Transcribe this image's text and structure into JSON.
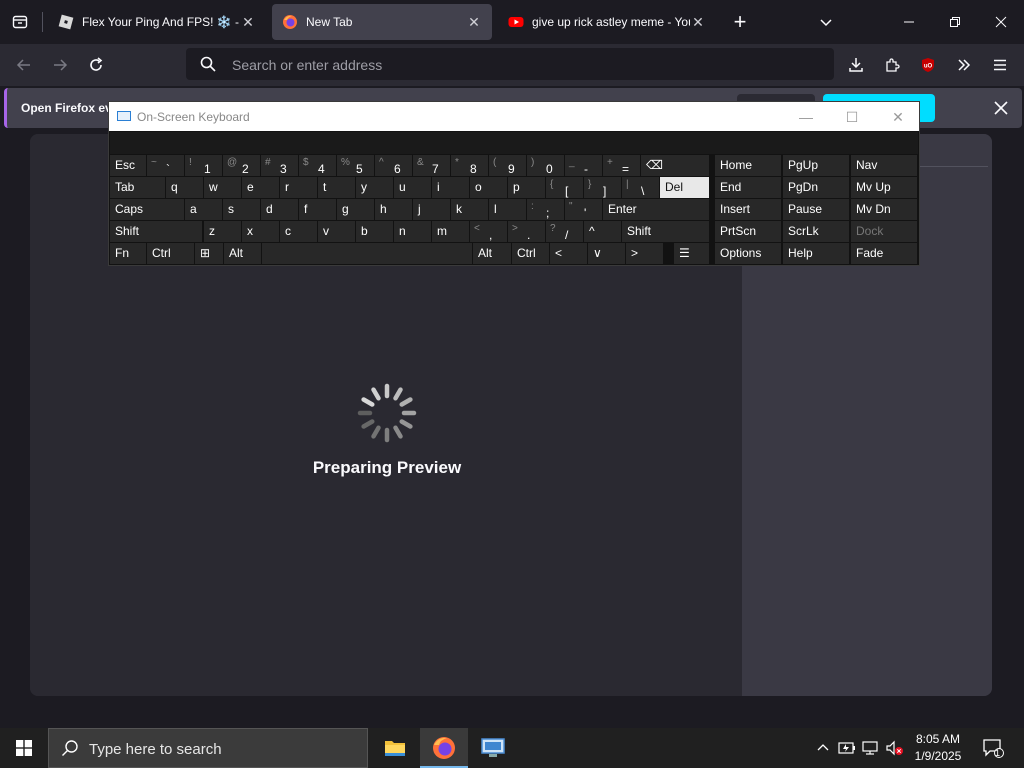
{
  "browser": {
    "tabs": [
      {
        "title": "Flex Your Ping And FPS! ❄️ - Roblox",
        "active": false
      },
      {
        "title": "New Tab",
        "active": true
      },
      {
        "title": "give up rick astley meme - YouTube",
        "active": false
      }
    ],
    "new_tab_symbol": "+",
    "url_placeholder": "Search or enter address",
    "notification": "Open Firefox everywhere you browse"
  },
  "content": {
    "status": "Preparing Preview"
  },
  "osk": {
    "title": "On-Screen Keyboard",
    "rows": [
      [
        {
          "label": "Esc"
        },
        {
          "shift": "~",
          "main": "`"
        },
        {
          "shift": "!",
          "main": "1"
        },
        {
          "shift": "@",
          "main": "2"
        },
        {
          "shift": "#",
          "main": "3"
        },
        {
          "shift": "$",
          "main": "4"
        },
        {
          "shift": "%",
          "main": "5"
        },
        {
          "shift": "^",
          "main": "6"
        },
        {
          "shift": "&",
          "main": "7"
        },
        {
          "shift": "*",
          "main": "8"
        },
        {
          "shift": "(",
          "main": "9"
        },
        {
          "shift": ")",
          "main": "0"
        },
        {
          "shift": "_",
          "main": "-"
        },
        {
          "shift": "+",
          "main": "="
        },
        {
          "label": "⌫"
        },
        {
          "label": "Home"
        },
        {
          "label": "PgUp"
        },
        {
          "label": "Nav"
        }
      ],
      [
        {
          "label": "Tab"
        },
        {
          "label": "q"
        },
        {
          "label": "w"
        },
        {
          "label": "e"
        },
        {
          "label": "r"
        },
        {
          "label": "t"
        },
        {
          "label": "y"
        },
        {
          "label": "u"
        },
        {
          "label": "i"
        },
        {
          "label": "o"
        },
        {
          "label": "p"
        },
        {
          "shift": "{",
          "main": "["
        },
        {
          "shift": "}",
          "main": "]"
        },
        {
          "shift": "|",
          "main": "\\"
        },
        {
          "label": "Del"
        },
        {
          "label": "End"
        },
        {
          "label": "PgDn"
        },
        {
          "label": "Mv Up"
        }
      ],
      [
        {
          "label": "Caps"
        },
        {
          "label": "a"
        },
        {
          "label": "s"
        },
        {
          "label": "d"
        },
        {
          "label": "f"
        },
        {
          "label": "g"
        },
        {
          "label": "h"
        },
        {
          "label": "j"
        },
        {
          "label": "k"
        },
        {
          "label": "l"
        },
        {
          "shift": ":",
          "main": ";"
        },
        {
          "shift": "\"",
          "main": "'"
        },
        {
          "label": "Enter"
        },
        {
          "label": "Insert"
        },
        {
          "label": "Pause"
        },
        {
          "label": "Mv Dn"
        }
      ],
      [
        {
          "label": "Shift"
        },
        {
          "label": "z"
        },
        {
          "label": "x"
        },
        {
          "label": "c"
        },
        {
          "label": "v"
        },
        {
          "label": "b"
        },
        {
          "label": "n"
        },
        {
          "label": "m"
        },
        {
          "shift": "<",
          "main": ","
        },
        {
          "shift": ">",
          "main": "."
        },
        {
          "shift": "?",
          "main": "/"
        },
        {
          "label": "^"
        },
        {
          "label": "Shift"
        },
        {
          "label": "PrtScn"
        },
        {
          "label": "ScrLk"
        },
        {
          "label": "Dock"
        }
      ],
      [
        {
          "label": "Fn"
        },
        {
          "label": "Ctrl"
        },
        {
          "label": "⊞"
        },
        {
          "label": "Alt"
        },
        {
          "label": ""
        },
        {
          "label": "Alt"
        },
        {
          "label": "Ctrl"
        },
        {
          "label": "<"
        },
        {
          "label": "∨"
        },
        {
          "label": ">"
        },
        {
          "label": "☰"
        },
        {
          "label": "Options"
        },
        {
          "label": "Help"
        },
        {
          "label": "Fade"
        }
      ]
    ]
  },
  "taskbar": {
    "search_placeholder": "Type here to search",
    "time": "8:05 AM",
    "date": "1/9/2025",
    "notification_count": "1"
  },
  "colors": {
    "accent": "#00ddff",
    "notif_border": "#a765e8",
    "youtube": "#ff0000",
    "firefox": "#ff7139"
  }
}
